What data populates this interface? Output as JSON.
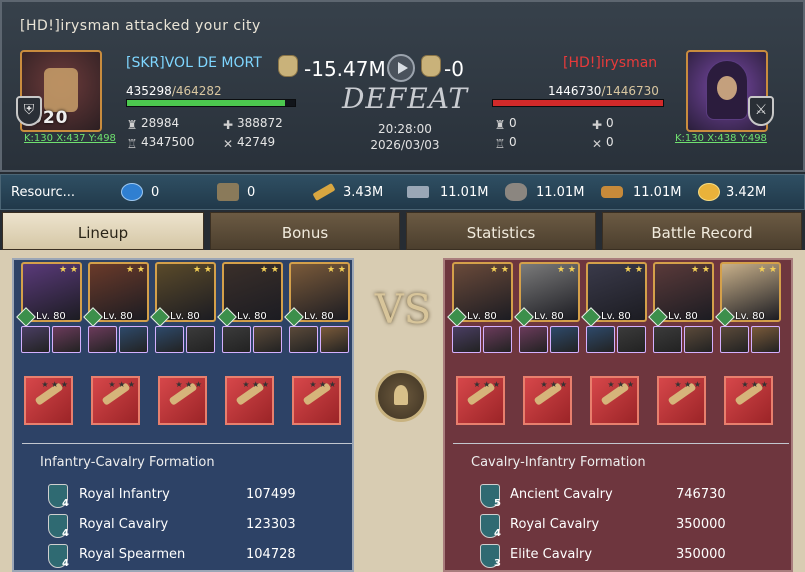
{
  "header": {
    "notice": "[HD!]irysman attacked your city",
    "result": "DEFEAT",
    "time": "20:28:00",
    "date": "2026/03/03"
  },
  "attacker": {
    "name": "[SKR]VOL DE MORT",
    "level_badge": "020",
    "coords": "K:130 X:437 Y:498",
    "loss": "-15.47M",
    "hp_current": "435298",
    "hp_max": "/464282",
    "hp_fraction": 0.9376,
    "stat_troops": "28984",
    "stat_power": "388872",
    "stat_tower": "4347500",
    "stat_kills": "42749"
  },
  "defender": {
    "name": "[HD!]irysman",
    "coords": "K:130 X:438 Y:498",
    "loss": "-0",
    "hp_current": "1446730",
    "hp_max": "/1446730",
    "hp_fraction": 1.0,
    "stat_troops": "0",
    "stat_power": "0",
    "stat_tower": "0",
    "stat_kills": "0"
  },
  "resources": {
    "label": "Resourc...",
    "exp": "0",
    "helmet": "0",
    "feather": "3.43M",
    "iron": "11.01M",
    "stone": "11.01M",
    "wood": "11.01M",
    "gold": "3.42M",
    "icons": [
      "exp-icon",
      "helmet-icon",
      "feather-icon",
      "iron-icon",
      "stone-icon",
      "wood-icon",
      "gold-icon"
    ]
  },
  "tabs": [
    "Lineup",
    "Bonus",
    "Statistics",
    "Battle Record"
  ],
  "left": {
    "heroes": [
      {
        "level": "Lv. 80",
        "color": "#5a3a7a"
      },
      {
        "level": "Lv. 80",
        "color": "#6a3a2a"
      },
      {
        "level": "Lv. 80",
        "color": "#5a4a2a"
      },
      {
        "level": "Lv. 80",
        "color": "#3a2f2a"
      },
      {
        "level": "Lv. 80",
        "color": "#7a5a3a"
      }
    ],
    "formation": "Infantry-Cavalry Formation",
    "troops": [
      {
        "name": "Royal Infantry",
        "tier": "4",
        "value": "107499",
        "icon": "infantry-icon"
      },
      {
        "name": "Royal Cavalry",
        "tier": "4",
        "value": "123303",
        "icon": "cavalry-icon"
      },
      {
        "name": "Royal Spearmen",
        "tier": "4",
        "value": "104728",
        "icon": "spearmen-icon"
      }
    ]
  },
  "right": {
    "heroes": [
      {
        "level": "Lv. 80",
        "color": "#6a4a3a"
      },
      {
        "level": "Lv. 80",
        "color": "#7a7a7a"
      },
      {
        "level": "Lv. 80",
        "color": "#3a3a4a"
      },
      {
        "level": "Lv. 80",
        "color": "#5a3a3a"
      },
      {
        "level": "Lv. 80",
        "color": "#c8b08a"
      }
    ],
    "formation": "Cavalry-Infantry Formation",
    "troops": [
      {
        "name": "Ancient Cavalry",
        "tier": "5",
        "value": "746730",
        "icon": "cavalry-icon"
      },
      {
        "name": "Royal Cavalry",
        "tier": "4",
        "value": "350000",
        "icon": "cavalry-icon"
      },
      {
        "name": "Elite Cavalry",
        "tier": "3",
        "value": "350000",
        "icon": "cavalry-icon"
      }
    ]
  },
  "vs_label": "VS",
  "colors": {
    "accent_green": "#4cc84f",
    "accent_red": "#d12a2a",
    "name_blue": "#7fd6ff"
  }
}
